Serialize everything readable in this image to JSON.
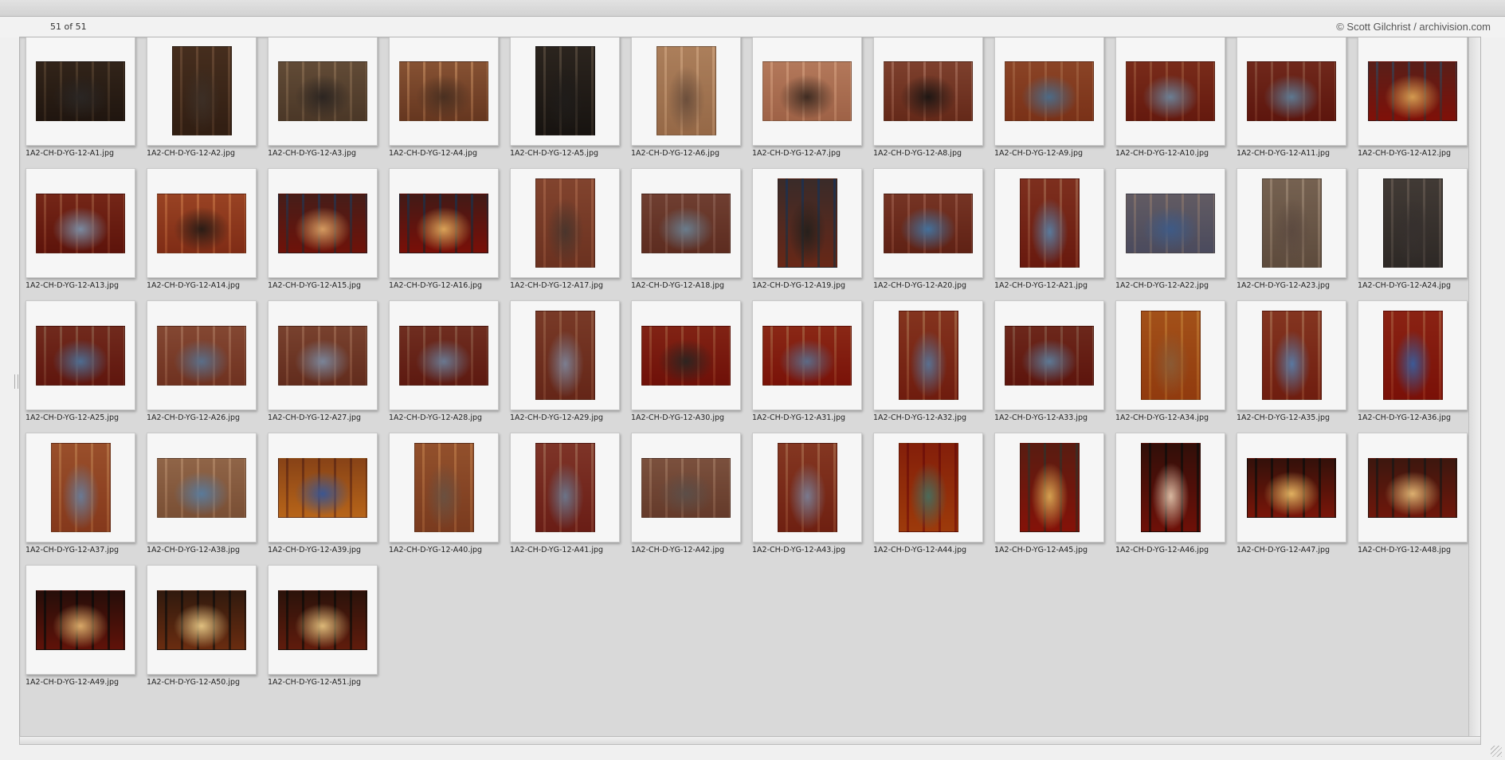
{
  "header": {
    "counter": "51 of 51",
    "credit": "© Scott Gilchrist / archivision.com"
  },
  "thumbnails": [
    {
      "filename": "1A2-CH-D-YG-12-A1.jpg",
      "orientation": "landscape",
      "colors": [
        "#5a4a3e",
        "#2a2624",
        "#8d7b68"
      ]
    },
    {
      "filename": "1A2-CH-D-YG-12-A2.jpg",
      "orientation": "portrait",
      "colors": [
        "#6f5744",
        "#3c2f26",
        "#a08670"
      ]
    },
    {
      "filename": "1A2-CH-D-YG-12-A3.jpg",
      "orientation": "landscape",
      "colors": [
        "#8a7764",
        "#2c2521",
        "#b4a08a"
      ]
    },
    {
      "filename": "1A2-CH-D-YG-12-A4.jpg",
      "orientation": "landscape",
      "colors": [
        "#a1765a",
        "#4a3021",
        "#d4b090"
      ]
    },
    {
      "filename": "1A2-CH-D-YG-12-A5.jpg",
      "orientation": "portrait",
      "colors": [
        "#4d4640",
        "#1f1c1a",
        "#8e8377"
      ]
    },
    {
      "filename": "1A2-CH-D-YG-12-A6.jpg",
      "orientation": "portrait",
      "colors": [
        "#c3a386",
        "#6c4f3c",
        "#e0c6ad"
      ]
    },
    {
      "filename": "1A2-CH-D-YG-12-A7.jpg",
      "orientation": "landscape",
      "colors": [
        "#c99e86",
        "#3f2c22",
        "#e3c2ac"
      ]
    },
    {
      "filename": "1A2-CH-D-YG-12-A8.jpg",
      "orientation": "landscape",
      "colors": [
        "#a06650",
        "#1f1714",
        "#c8a090"
      ]
    },
    {
      "filename": "1A2-CH-D-YG-12-A9.jpg",
      "orientation": "landscape",
      "colors": [
        "#b0704e",
        "#4c6a86",
        "#c89a7c"
      ]
    },
    {
      "filename": "1A2-CH-D-YG-12-A10.jpg",
      "orientation": "landscape",
      "colors": [
        "#a0503c",
        "#6b7f94",
        "#c08a70"
      ]
    },
    {
      "filename": "1A2-CH-D-YG-12-A11.jpg",
      "orientation": "landscape",
      "colors": [
        "#9a4a3a",
        "#5e7890",
        "#b98a78"
      ]
    },
    {
      "filename": "1A2-CH-D-YG-12-A12.jpg",
      "orientation": "landscape",
      "colors": [
        "#b4402e",
        "#d39a50",
        "#7d7a88"
      ]
    },
    {
      "filename": "1A2-CH-D-YG-12-A13.jpg",
      "orientation": "landscape",
      "colors": [
        "#9a4634",
        "#7a8aa0",
        "#c08a72"
      ]
    },
    {
      "filename": "1A2-CH-D-YG-12-A14.jpg",
      "orientation": "landscape",
      "colors": [
        "#b46a4a",
        "#2a1c16",
        "#d8a07a"
      ]
    },
    {
      "filename": "1A2-CH-D-YG-12-A15.jpg",
      "orientation": "landscape",
      "colors": [
        "#a84430",
        "#d49a60",
        "#6a6e84"
      ]
    },
    {
      "filename": "1A2-CH-D-YG-12-A16.jpg",
      "orientation": "landscape",
      "colors": [
        "#b03e2c",
        "#d9a258",
        "#5f6a80"
      ]
    },
    {
      "filename": "1A2-CH-D-YG-12-A17.jpg",
      "orientation": "portrait",
      "colors": [
        "#a5705a",
        "#4a352c",
        "#c89a82"
      ]
    },
    {
      "filename": "1A2-CH-D-YG-12-A18.jpg",
      "orientation": "landscape",
      "colors": [
        "#9a6a5a",
        "#6a7c8c",
        "#b8968a"
      ]
    },
    {
      "filename": "1A2-CH-D-YG-12-A19.jpg",
      "orientation": "portrait",
      "colors": [
        "#a3644c",
        "#26201c",
        "#5a6e8a"
      ]
    },
    {
      "filename": "1A2-CH-D-YG-12-A20.jpg",
      "orientation": "landscape",
      "colors": [
        "#9c5c48",
        "#44709a",
        "#c09080"
      ]
    },
    {
      "filename": "1A2-CH-D-YG-12-A21.jpg",
      "orientation": "portrait",
      "colors": [
        "#a3503c",
        "#5a7a9c",
        "#c49680"
      ]
    },
    {
      "filename": "1A2-CH-D-YG-12-A22.jpg",
      "orientation": "landscape",
      "colors": [
        "#8a8a9a",
        "#3e5a86",
        "#b4a8a4"
      ]
    },
    {
      "filename": "1A2-CH-D-YG-12-A23.jpg",
      "orientation": "portrait",
      "colors": [
        "#9a8a7c",
        "#5c4a40",
        "#c2b4a6"
      ]
    },
    {
      "filename": "1A2-CH-D-YG-12-A24.jpg",
      "orientation": "portrait",
      "colors": [
        "#6c6662",
        "#36302e",
        "#9a918a"
      ]
    },
    {
      "filename": "1A2-CH-D-YG-12-A25.jpg",
      "orientation": "landscape",
      "colors": [
        "#9c4a3a",
        "#4e6c90",
        "#b8907e"
      ]
    },
    {
      "filename": "1A2-CH-D-YG-12-A26.jpg",
      "orientation": "landscape",
      "colors": [
        "#a8705a",
        "#5a6e88",
        "#c8a28e"
      ]
    },
    {
      "filename": "1A2-CH-D-YG-12-A27.jpg",
      "orientation": "landscape",
      "colors": [
        "#9e6a56",
        "#7a8498",
        "#c29c88"
      ]
    },
    {
      "filename": "1A2-CH-D-YG-12-A28.jpg",
      "orientation": "landscape",
      "colors": [
        "#9a5040",
        "#6a7890",
        "#b8907e"
      ]
    },
    {
      "filename": "1A2-CH-D-YG-12-A29.jpg",
      "orientation": "portrait",
      "colors": [
        "#a0624e",
        "#7c7e90",
        "#c09680"
      ]
    },
    {
      "filename": "1A2-CH-D-YG-12-A30.jpg",
      "orientation": "landscape",
      "colors": [
        "#a8402e",
        "#2e2420",
        "#c48a70"
      ]
    },
    {
      "filename": "1A2-CH-D-YG-12-A31.jpg",
      "orientation": "landscape",
      "colors": [
        "#b0442e",
        "#5c6a86",
        "#c89478"
      ]
    },
    {
      "filename": "1A2-CH-D-YG-12-A32.jpg",
      "orientation": "portrait",
      "colors": [
        "#a8543c",
        "#5a7090",
        "#c89c80"
      ]
    },
    {
      "filename": "1A2-CH-D-YG-12-A33.jpg",
      "orientation": "landscape",
      "colors": [
        "#9a4838",
        "#5d7894",
        "#b48c7c"
      ]
    },
    {
      "filename": "1A2-CH-D-YG-12-A34.jpg",
      "orientation": "portrait",
      "colors": [
        "#c07a3c",
        "#8a5a34",
        "#d8a86a"
      ]
    },
    {
      "filename": "1A2-CH-D-YG-12-A35.jpg",
      "orientation": "portrait",
      "colors": [
        "#a8563e",
        "#5a78a0",
        "#c89c84"
      ]
    },
    {
      "filename": "1A2-CH-D-YG-12-A36.jpg",
      "orientation": "portrait",
      "colors": [
        "#b0402c",
        "#3c5a96",
        "#c88a70"
      ]
    },
    {
      "filename": "1A2-CH-D-YG-12-A37.jpg",
      "orientation": "portrait",
      "colors": [
        "#b87854",
        "#6a7a94",
        "#d4a882"
      ]
    },
    {
      "filename": "1A2-CH-D-YG-12-A38.jpg",
      "orientation": "landscape",
      "colors": [
        "#b08e74",
        "#5a7a9a",
        "#d0b49c"
      ]
    },
    {
      "filename": "1A2-CH-D-YG-12-A39.jpg",
      "orientation": "landscape",
      "colors": [
        "#d8a050",
        "#3c5690",
        "#a06a48"
      ]
    },
    {
      "filename": "1A2-CH-D-YG-12-A40.jpg",
      "orientation": "portrait",
      "colors": [
        "#b07a58",
        "#6a5040",
        "#d4a880"
      ]
    },
    {
      "filename": "1A2-CH-D-YG-12-A41.jpg",
      "orientation": "portrait",
      "colors": [
        "#a4564a",
        "#6c7488",
        "#c49a88"
      ]
    },
    {
      "filename": "1A2-CH-D-YG-12-A42.jpg",
      "orientation": "landscape",
      "colors": [
        "#a07a68",
        "#5c4e48",
        "#c4a896"
      ]
    },
    {
      "filename": "1A2-CH-D-YG-12-A43.jpg",
      "orientation": "portrait",
      "colors": [
        "#a85a42",
        "#7a7a8e",
        "#c89a80"
      ]
    },
    {
      "filename": "1A2-CH-D-YG-12-A44.jpg",
      "orientation": "portrait",
      "colors": [
        "#c87a34",
        "#4a6a5a",
        "#a84030"
      ]
    },
    {
      "filename": "1A2-CH-D-YG-12-A45.jpg",
      "orientation": "portrait",
      "colors": [
        "#b8442e",
        "#d4a050",
        "#7a6a60"
      ]
    },
    {
      "filename": "1A2-CH-D-YG-12-A46.jpg",
      "orientation": "portrait",
      "colors": [
        "#a8402e",
        "#d8b8a0",
        "#4a3a34"
      ]
    },
    {
      "filename": "1A2-CH-D-YG-12-A47.jpg",
      "orientation": "landscape",
      "colors": [
        "#b04a30",
        "#e0b060",
        "#4a3a34"
      ]
    },
    {
      "filename": "1A2-CH-D-YG-12-A48.jpg",
      "orientation": "landscape",
      "colors": [
        "#a84c34",
        "#dcb070",
        "#5c4c48"
      ]
    },
    {
      "filename": "1A2-CH-D-YG-12-A49.jpg",
      "orientation": "landscape",
      "colors": [
        "#9c4430",
        "#d8a868",
        "#3e3430"
      ]
    },
    {
      "filename": "1A2-CH-D-YG-12-A50.jpg",
      "orientation": "landscape",
      "colors": [
        "#a46a40",
        "#e0c080",
        "#4c3e36"
      ]
    },
    {
      "filename": "1A2-CH-D-YG-12-A51.jpg",
      "orientation": "landscape",
      "colors": [
        "#9c5438",
        "#dcb878",
        "#46382e"
      ]
    }
  ]
}
